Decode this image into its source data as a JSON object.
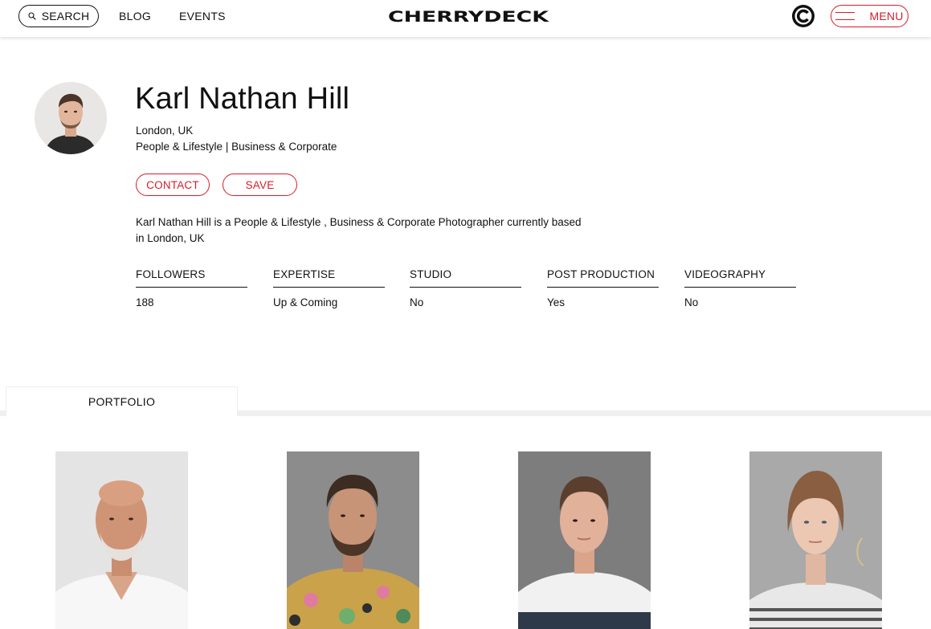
{
  "header": {
    "search_label": "SEARCH",
    "nav": [
      {
        "label": "BLOG"
      },
      {
        "label": "EVENTS"
      }
    ],
    "logo_text": "CHERRYDECK",
    "menu_label": "MENU",
    "accent_color": "#d61d2a"
  },
  "profile": {
    "name": "Karl Nathan Hill",
    "location": "London, UK",
    "categories": "People & Lifestyle | Business & Corporate",
    "contact_label": "CONTACT",
    "save_label": "SAVE",
    "bio": "Karl Nathan Hill is a People & Lifestyle ,  Business & Corporate Photographer currently based in London, UK"
  },
  "stats": [
    {
      "label": "FOLLOWERS",
      "value": "188"
    },
    {
      "label": "EXPERTISE",
      "value": "Up & Coming"
    },
    {
      "label": "STUDIO",
      "value": "No"
    },
    {
      "label": "POST PRODUCTION",
      "value": "Yes"
    },
    {
      "label": "VIDEOGRAPHY",
      "value": "No"
    }
  ],
  "tabs": [
    {
      "label": "PORTFOLIO",
      "active": true
    }
  ],
  "portfolio": {
    "photos": [
      {
        "subject": "older man with white beard in white shirt"
      },
      {
        "subject": "man with beard in floral shirt"
      },
      {
        "subject": "young man in white t-shirt"
      },
      {
        "subject": "young woman in striped top"
      }
    ]
  }
}
